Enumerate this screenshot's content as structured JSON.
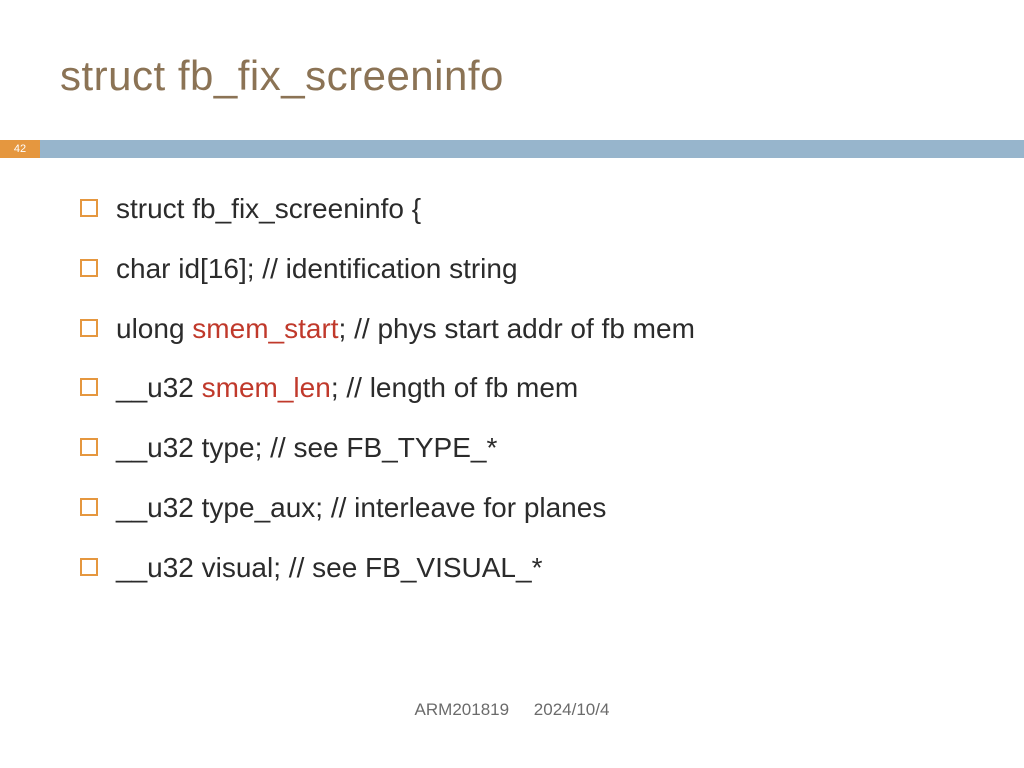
{
  "title": "struct fb_fix_screeninfo",
  "page_number": "42",
  "colors": {
    "title": "#8b7355",
    "badge_bg": "#e5973f",
    "bar_bg": "#97b5cc",
    "highlight": "#c0392b"
  },
  "bullets": [
    {
      "pre": "struct fb_fix_screeninfo {",
      "hl": "",
      "post": ""
    },
    {
      "pre": "char id[16]; // identification string",
      "hl": "",
      "post": ""
    },
    {
      "pre": "ulong ",
      "hl": "smem_start",
      "post": "; // phys start addr of fb mem"
    },
    {
      "pre": "__u32 ",
      "hl": "smem_len",
      "post": "; // length of fb mem"
    },
    {
      "pre": "__u32 type; // see FB_TYPE_*",
      "hl": "",
      "post": ""
    },
    {
      "pre": "__u32 type_aux; // interleave for planes",
      "hl": "",
      "post": ""
    },
    {
      "pre": "__u32 visual; // see FB_VISUAL_*",
      "hl": "",
      "post": ""
    }
  ],
  "footer": {
    "course": "ARM201819",
    "date": "2024/10/4"
  }
}
